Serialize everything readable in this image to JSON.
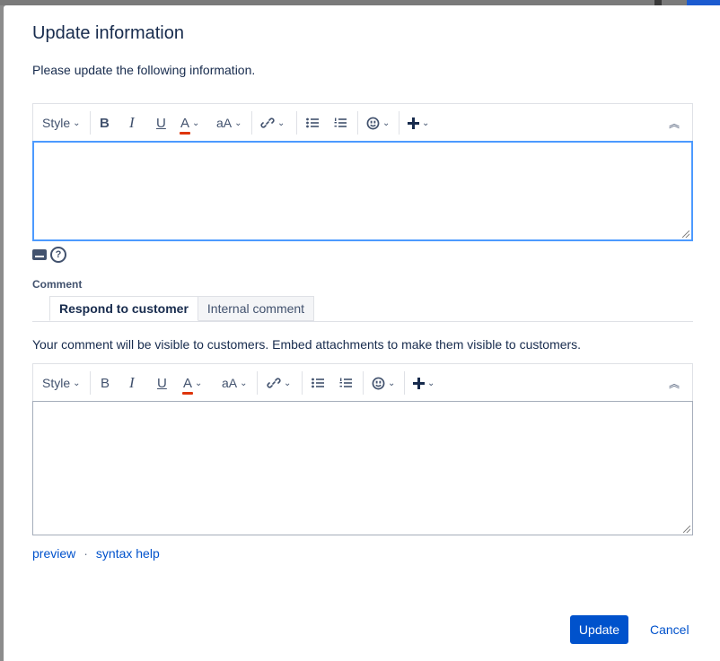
{
  "dialog": {
    "title": "Update information",
    "description": "Please update the following information."
  },
  "toolbar": {
    "style_label": "Style",
    "bold": "B",
    "italic": "I",
    "underline": "U",
    "text_color": "A",
    "text_size": "aA",
    "chevron": "⌄",
    "collapse": "︽"
  },
  "comment": {
    "label": "Comment",
    "tabs": [
      "Respond to customer",
      "Internal comment"
    ],
    "note": "Your comment will be visible to customers. Embed attachments to make them visible to customers."
  },
  "links": {
    "preview": "preview",
    "separator": "·",
    "syntax_help": "syntax help"
  },
  "footer": {
    "update": "Update",
    "cancel": "Cancel"
  },
  "help_glyph": "?",
  "colors": {
    "accent": "#0052cc",
    "focus_border": "#4c9aff",
    "text_color_underline": "#de350b"
  }
}
